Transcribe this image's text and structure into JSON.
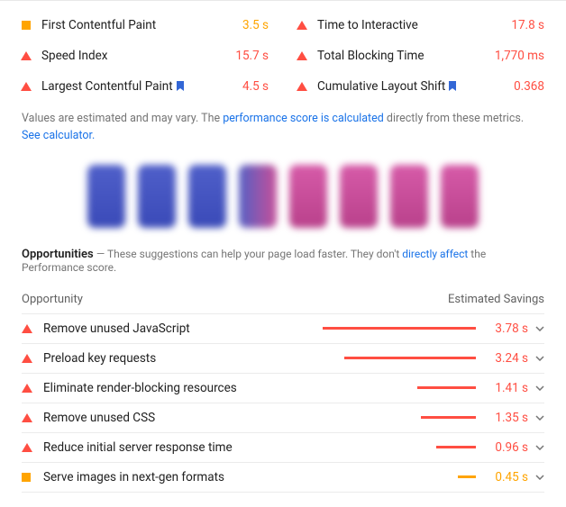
{
  "metrics": [
    {
      "icon": "square",
      "label": "First Contentful Paint",
      "value": "3.5 s",
      "color": "orange",
      "bookmark": false
    },
    {
      "icon": "triangle",
      "label": "Time to Interactive",
      "value": "17.8 s",
      "color": "red",
      "bookmark": false
    },
    {
      "icon": "triangle",
      "label": "Speed Index",
      "value": "15.7 s",
      "color": "red",
      "bookmark": false
    },
    {
      "icon": "triangle",
      "label": "Total Blocking Time",
      "value": "1,770 ms",
      "color": "red",
      "bookmark": false
    },
    {
      "icon": "triangle",
      "label": "Largest Contentful Paint",
      "value": "4.5 s",
      "color": "red",
      "bookmark": true
    },
    {
      "icon": "triangle",
      "label": "Cumulative Layout Shift",
      "value": "0.368",
      "color": "red",
      "bookmark": true
    }
  ],
  "disclaimer": {
    "pre": "Values are estimated and may vary. The ",
    "link1": "performance score is calculated",
    "mid": " directly from these metrics. ",
    "link2": "See calculator."
  },
  "filmstrip_colors": [
    "blue",
    "blue",
    "blue",
    "mix",
    "pink",
    "pink",
    "pink",
    "pink"
  ],
  "opps_title": "Opportunities",
  "opps_subtitle_pre": "— These suggestions can help your page load faster. They don't ",
  "opps_subtitle_link": "directly affect",
  "opps_subtitle_post": " the Performance score.",
  "opps_header_left": "Opportunity",
  "opps_header_right": "Estimated Savings",
  "opportunities": [
    {
      "icon": "triangle",
      "label": "Remove unused JavaScript",
      "value": "3.78 s",
      "fill": 100,
      "barColor": "red"
    },
    {
      "icon": "triangle",
      "label": "Preload key requests",
      "value": "3.24 s",
      "fill": 86,
      "barColor": "red"
    },
    {
      "icon": "triangle",
      "label": "Eliminate render-blocking resources",
      "value": "1.41 s",
      "fill": 38,
      "barColor": "red"
    },
    {
      "icon": "triangle",
      "label": "Remove unused CSS",
      "value": "1.35 s",
      "fill": 36,
      "barColor": "red"
    },
    {
      "icon": "triangle",
      "label": "Reduce initial server response time",
      "value": "0.96 s",
      "fill": 26,
      "barColor": "red"
    },
    {
      "icon": "square",
      "label": "Serve images in next-gen formats",
      "value": "0.45 s",
      "fill": 12,
      "barColor": "orange"
    }
  ],
  "chart_data": {
    "type": "table",
    "title": "Lighthouse Performance Metrics & Opportunities",
    "metrics": [
      {
        "name": "First Contentful Paint",
        "value": 3.5,
        "unit": "s",
        "status": "average"
      },
      {
        "name": "Time to Interactive",
        "value": 17.8,
        "unit": "s",
        "status": "poor"
      },
      {
        "name": "Speed Index",
        "value": 15.7,
        "unit": "s",
        "status": "poor"
      },
      {
        "name": "Total Blocking Time",
        "value": 1770,
        "unit": "ms",
        "status": "poor"
      },
      {
        "name": "Largest Contentful Paint",
        "value": 4.5,
        "unit": "s",
        "status": "poor"
      },
      {
        "name": "Cumulative Layout Shift",
        "value": 0.368,
        "unit": "",
        "status": "poor"
      }
    ],
    "opportunities": [
      {
        "name": "Remove unused JavaScript",
        "savings_s": 3.78
      },
      {
        "name": "Preload key requests",
        "savings_s": 3.24
      },
      {
        "name": "Eliminate render-blocking resources",
        "savings_s": 1.41
      },
      {
        "name": "Remove unused CSS",
        "savings_s": 1.35
      },
      {
        "name": "Reduce initial server response time",
        "savings_s": 0.96
      },
      {
        "name": "Serve images in next-gen formats",
        "savings_s": 0.45
      }
    ]
  }
}
